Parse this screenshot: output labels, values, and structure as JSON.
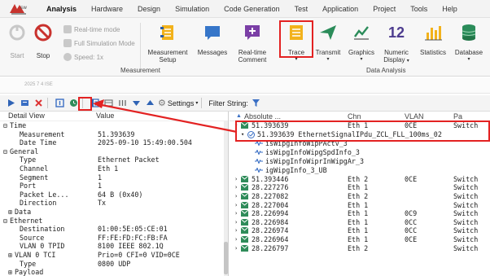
{
  "menu": {
    "items": [
      "Analysis",
      "Hardware",
      "Design",
      "Simulation",
      "Code Generation",
      "Test",
      "Application",
      "Project",
      "Tools",
      "Help"
    ],
    "active": "Analysis"
  },
  "ribbon": {
    "start": "Start",
    "stop": "Stop",
    "realtime_mode": "Real-time mode",
    "full_sim_mode": "Full Simulation Mode",
    "speed": "Speed: 1x",
    "measurement_setup_l1": "Measurement",
    "measurement_setup_l2": "Setup",
    "messages": "Messages",
    "realtime_comment_l1": "Real-time",
    "realtime_comment_l2": "Comment",
    "trace": "Trace",
    "transmit": "Transmit",
    "graphics": "Graphics",
    "numeric_l1": "Numeric",
    "numeric_l2": "Display",
    "statistics": "Statistics",
    "database": "Database",
    "group_measurement": "Measurement",
    "group_data_analysis": "Data Analysis",
    "numeric_glyph": "12"
  },
  "strip": {
    "label": "2025 7 4 ISE"
  },
  "toolbar": {
    "settings": "Settings",
    "filter_label": "Filter String:"
  },
  "detail": {
    "header_view": "Detail View",
    "header_value": "Value",
    "rows": [
      {
        "tog": "⊟",
        "key": "Time",
        "val": "",
        "indent": 0
      },
      {
        "tog": "",
        "key": "Measurement",
        "val": "51.393639",
        "indent": 2
      },
      {
        "tog": "",
        "key": "Date Time",
        "val": "2025-09-10 15:49:00.504",
        "indent": 2
      },
      {
        "tog": "⊟",
        "key": "General",
        "val": "",
        "indent": 0
      },
      {
        "tog": "",
        "key": "Type",
        "val": "Ethernet Packet",
        "indent": 2
      },
      {
        "tog": "",
        "key": "Channel",
        "val": "Eth 1",
        "indent": 2
      },
      {
        "tog": "",
        "key": "Segment",
        "val": "1",
        "indent": 2
      },
      {
        "tog": "",
        "key": "Port",
        "val": "1",
        "indent": 2
      },
      {
        "tog": "",
        "key": "Packet Le...",
        "val": "64 B (0x40)",
        "indent": 2
      },
      {
        "tog": "",
        "key": "Direction",
        "val": "Tx",
        "indent": 2
      },
      {
        "tog": "⊞",
        "key": "Data",
        "val": "",
        "indent": 1
      },
      {
        "tog": "⊟",
        "key": "Ethernet",
        "val": "",
        "indent": 0
      },
      {
        "tog": "",
        "key": "Destination",
        "val": "01:00:5E:05:CE:01",
        "indent": 2
      },
      {
        "tog": "",
        "key": "Source",
        "val": "FF:FE:FD:FC:FB:FA",
        "indent": 2
      },
      {
        "tog": "",
        "key": "VLAN 0 TPID",
        "val": "8100 IEEE 802.1Q",
        "indent": 2
      },
      {
        "tog": "⊞",
        "key": "VLAN 0 TCI",
        "val": "Prio=0 CFI=0 VID=0CE",
        "indent": 1
      },
      {
        "tog": "",
        "key": "Type",
        "val": "0800 UDP",
        "indent": 2
      },
      {
        "tog": "⊞",
        "key": "Payload",
        "val": "",
        "indent": 1
      }
    ]
  },
  "grid": {
    "headers": {
      "absolute": "Absolute ...",
      "chn": "Chn",
      "vlan": "VLAN",
      "rest": "Pa"
    },
    "first_row": {
      "time": "51.393639",
      "chn": "Eth 1",
      "vlan": "0CE",
      "rest": "Switch"
    },
    "pdu_row": {
      "time": "51.393639",
      "name": "EthernetSignalIPdu_ZCL_FLL_100ms_02"
    },
    "signals": [
      "isWipgInfoWipPActv_3",
      "isWipgInfoWipgSpdInfo_3",
      "isWipgInfoWiprInWipgAr_3",
      "igWipgInfo_3_UB"
    ],
    "rows": [
      {
        "time": "51.393446",
        "chn": "Eth 2",
        "vlan": "0CE",
        "rest": "Switch"
      },
      {
        "time": "28.227276",
        "chn": "Eth 1",
        "vlan": "",
        "rest": "Switch"
      },
      {
        "time": "28.227082",
        "chn": "Eth 2",
        "vlan": "",
        "rest": "Switch"
      },
      {
        "time": "28.227004",
        "chn": "Eth 1",
        "vlan": "",
        "rest": "Switch"
      },
      {
        "time": "28.226994",
        "chn": "Eth 1",
        "vlan": "0C9",
        "rest": "Switch"
      },
      {
        "time": "28.226984",
        "chn": "Eth 1",
        "vlan": "0CC",
        "rest": "Switch"
      },
      {
        "time": "28.226974",
        "chn": "Eth 1",
        "vlan": "0CC",
        "rest": "Switch"
      },
      {
        "time": "28.226964",
        "chn": "Eth 1",
        "vlan": "0CE",
        "rest": "Switch"
      },
      {
        "time": "28.226797",
        "chn": "Eth 2",
        "vlan": "",
        "rest": "Switch"
      }
    ]
  },
  "colors": {
    "highlight": "#e32222",
    "msg_icon": "#2f8c5a",
    "signal_icon": "#3a6fc4"
  }
}
